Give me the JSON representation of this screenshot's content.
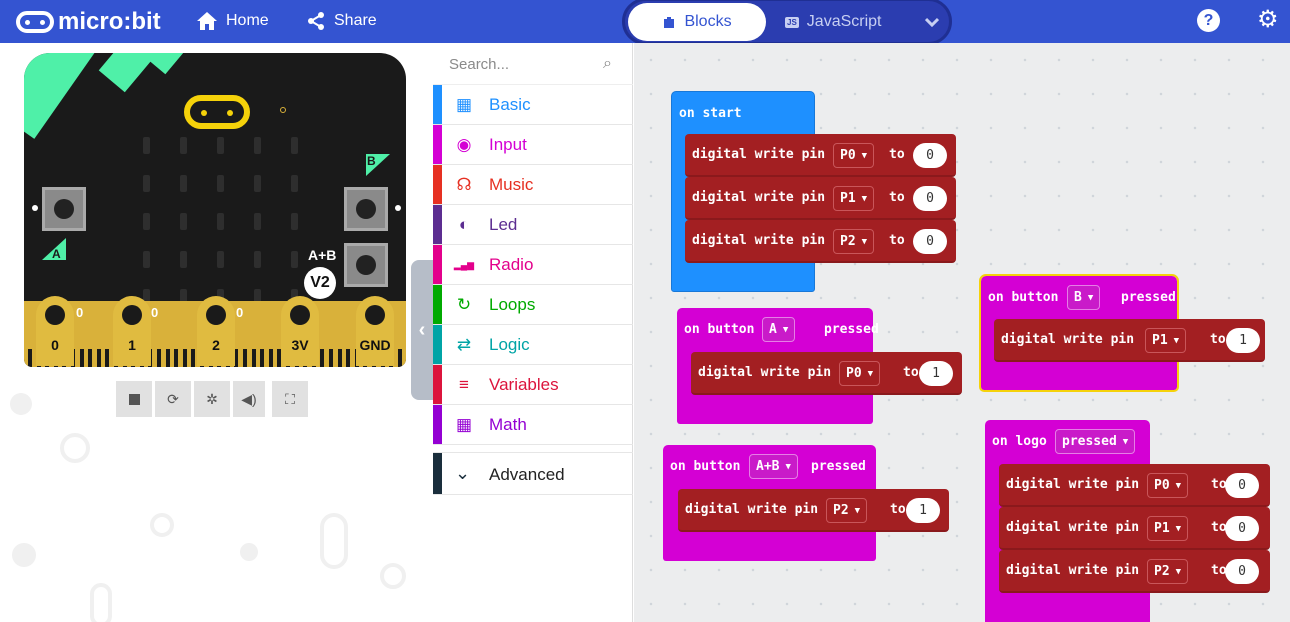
{
  "header": {
    "brand": "micro:bit",
    "home": "Home",
    "share": "Share",
    "tab_blocks": "Blocks",
    "tab_js": "JavaScript",
    "js_badge": "JS",
    "help": "?",
    "settings": "⚙"
  },
  "simulator": {
    "button_a": "A",
    "button_b": "B",
    "button_ab": "A+B",
    "version": "V2",
    "pins": [
      "0",
      "1",
      "2",
      "3V",
      "GND"
    ],
    "pin_values": [
      "0",
      "0",
      "0"
    ],
    "controls": [
      "stop",
      "restart",
      "debug",
      "mute",
      "fullscreen"
    ]
  },
  "toolbox": {
    "search_placeholder": "Search...",
    "categories": [
      {
        "label": "Basic",
        "color": "#1e90ff",
        "icon": "grid-icon"
      },
      {
        "label": "Input",
        "color": "#d400d4",
        "icon": "circle-dot-icon"
      },
      {
        "label": "Music",
        "color": "#e63022",
        "icon": "headphones-icon"
      },
      {
        "label": "Led",
        "color": "#5c2d91",
        "icon": "toggle-icon"
      },
      {
        "label": "Radio",
        "color": "#e3008c",
        "icon": "signal-icon"
      },
      {
        "label": "Loops",
        "color": "#00aa00",
        "icon": "refresh-icon"
      },
      {
        "label": "Logic",
        "color": "#00a4a6",
        "icon": "shuffle-icon"
      },
      {
        "label": "Variables",
        "color": "#dc143c",
        "icon": "list-icon"
      },
      {
        "label": "Math",
        "color": "#9400d3",
        "icon": "calculator-icon"
      }
    ],
    "advanced": "Advanced"
  },
  "workspace": {
    "kw_on_start": "on start",
    "kw_on_button": "on button",
    "kw_pressed": "pressed",
    "kw_on_logo": "on logo",
    "kw_digital_write": "digital write pin",
    "kw_to": "to",
    "on_start": [
      {
        "pin": "P0",
        "value": "0"
      },
      {
        "pin": "P1",
        "value": "0"
      },
      {
        "pin": "P2",
        "value": "0"
      }
    ],
    "button_a": {
      "button": "A",
      "pin": "P0",
      "value": "1"
    },
    "button_b": {
      "button": "B",
      "pin": "P1",
      "value": "1"
    },
    "button_ab": {
      "button": "A+B",
      "pin": "P2",
      "value": "1"
    },
    "on_logo": {
      "event": "pressed",
      "writes": [
        {
          "pin": "P0",
          "value": "0"
        },
        {
          "pin": "P1",
          "value": "0"
        },
        {
          "pin": "P2",
          "value": "0"
        }
      ]
    }
  },
  "colors": {
    "header": "#3454d1",
    "hat_start": "#1e90ff",
    "hat_input": "#d400d4",
    "pins_block": "#a31f22"
  }
}
